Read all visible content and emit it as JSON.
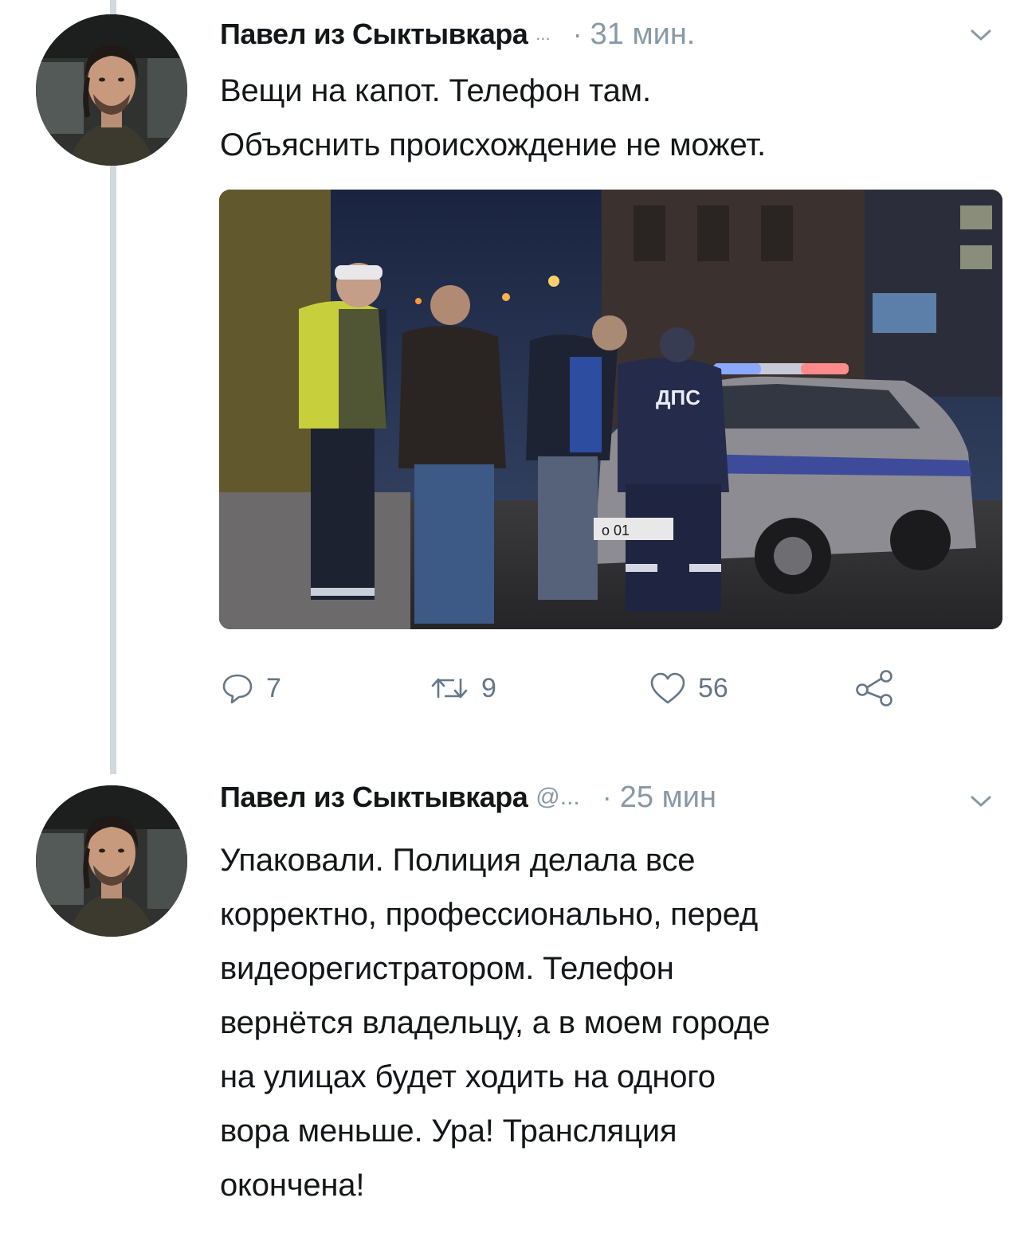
{
  "tweets": [
    {
      "author": "Павел из Сыктывкара",
      "handle": "...",
      "separator": "·",
      "time": "31 мин.",
      "text": "Вещи на капот. Телефон там.\nОбъяснить происхождение не может.",
      "photo": {
        "vehicle_lettering": "ДПС",
        "plate_text": "о 01"
      },
      "actions": {
        "replies": "7",
        "retweets": "9",
        "likes": "56"
      }
    },
    {
      "author": "Павел из Сыктывкара",
      "handle": "@...",
      "separator": "·",
      "time": "25 мин",
      "text": "Упаковали. Полиция делала все\nкорректно, профессионально, перед\nвидеорегистратором. Телефон\nвернётся владельцу, а в моем городе\nна улицах будет ходить на одного\nвора меньше. Ура! Трансляция\nокончена!"
    }
  ],
  "icons": {
    "reply": "reply-icon",
    "retweet": "retweet-icon",
    "like": "heart-icon",
    "share": "share-icon",
    "menu": "chevron-down-icon"
  },
  "colors": {
    "text": "#14171a",
    "secondary": "#657786",
    "muted": "#8899a6",
    "thread_line": "#cfd9de"
  }
}
